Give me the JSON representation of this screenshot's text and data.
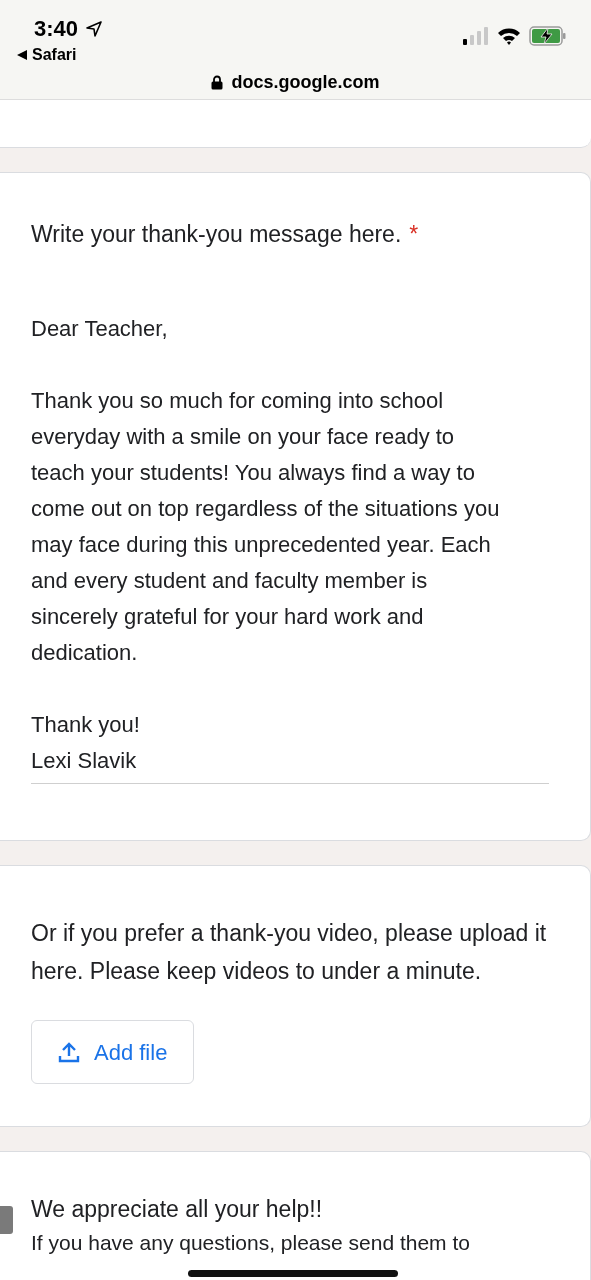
{
  "status_bar": {
    "time": "3:40",
    "back_label": "Safari",
    "url": "docs.google.com"
  },
  "questions": [
    {
      "kind": "text_answer",
      "title": "Write your thank-you message here.",
      "required": true,
      "required_mark": "*",
      "answer": "Dear Teacher,\n\nThank you so much for coming into school everyday with a smile on your face ready to teach your students! You always find a way to come out on top regardless of the situations you may face during this unprecedented year. Each and every student and faculty member is sincerely grateful for your hard work and dedication.\n\nThank you!\nLexi Slavik"
    },
    {
      "kind": "file_upload",
      "title": "Or if you prefer a thank-you video, please upload it here. Please keep videos to under a minute.",
      "button": "Add file"
    },
    {
      "kind": "section",
      "title": "We appreciate all your help!!",
      "description": "If you have any questions, please send them to"
    }
  ]
}
